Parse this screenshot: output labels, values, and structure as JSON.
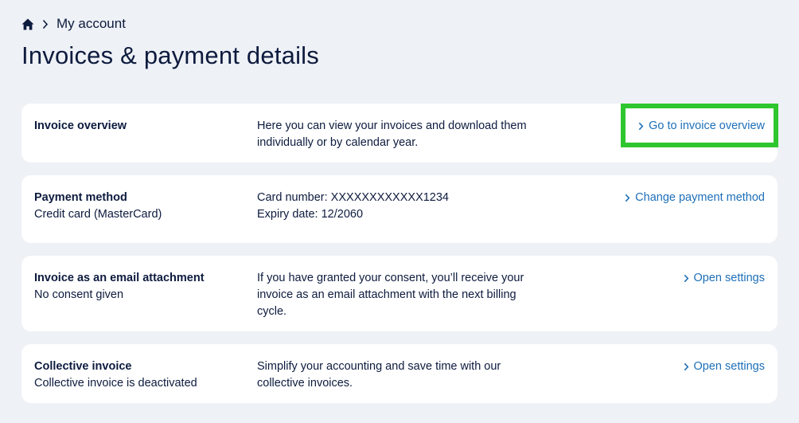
{
  "breadcrumb": {
    "home_icon": "home-icon",
    "separator_icon": "chevron-right-icon",
    "current": "My account"
  },
  "page": {
    "title": "Invoices & payment details"
  },
  "colors": {
    "link": "#1d6fb8",
    "highlight": "#2ec62e",
    "background": "#eef1f5",
    "text": "#0d1b3e"
  },
  "cards": [
    {
      "title": "Invoice overview",
      "subtitle": "",
      "description_lines": [
        "Here you can view your invoices and download them",
        "individually or by calendar year."
      ],
      "action": "Go to invoice overview"
    },
    {
      "title": "Payment method",
      "subtitle": "Credit card (MasterCard)",
      "description_lines": [
        "Card number: XXXXXXXXXXXX1234",
        "Expiry date: 12/2060"
      ],
      "action": "Change payment method"
    },
    {
      "title": "Invoice as an email attachment",
      "subtitle": "No consent given",
      "description_lines": [
        "If you have granted your consent, you’ll receive your",
        "invoice as an email attachment with the next billing",
        "cycle."
      ],
      "action": "Open settings"
    },
    {
      "title": "Collective invoice",
      "subtitle": "Collective invoice is deactivated",
      "description_lines": [
        "Simplify your accounting and save time with our",
        "collective invoices."
      ],
      "action": "Open settings"
    }
  ]
}
